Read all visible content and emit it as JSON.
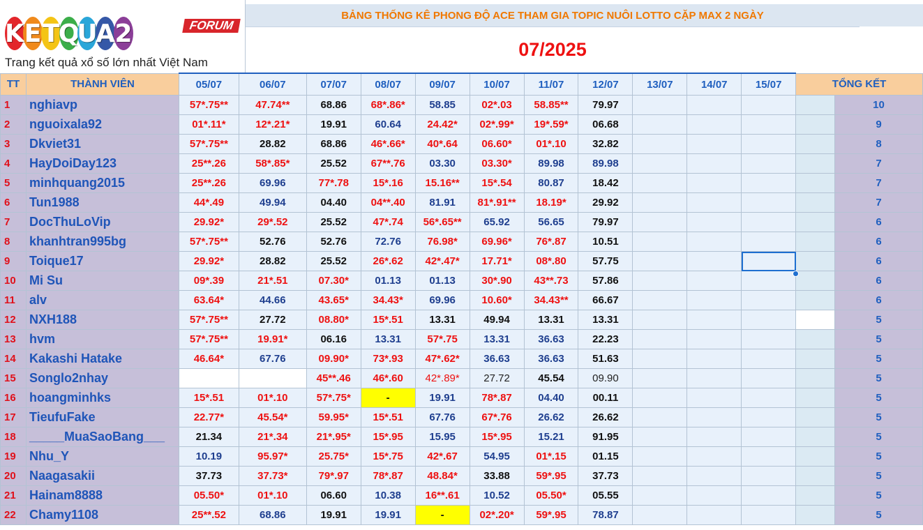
{
  "logo": {
    "letters": [
      "K",
      "E",
      "T",
      "Q",
      "U",
      "A",
      "2"
    ],
    "colors": [
      "#e3262b",
      "#f08a1c",
      "#f4c415",
      "#3bae49",
      "#2aa6d9",
      "#3558a7",
      "#8b3e98"
    ],
    "badge": "FORUM",
    "tagline": "Trang kết quả xổ số lớn nhất Việt Nam"
  },
  "title": "BẢNG THỐNG KÊ PHONG ĐỘ ACE THAM GIA TOPIC NUÔI LOTTO CẶP MAX 2 NGÀY",
  "month": "07/2025",
  "headers": {
    "tt": "TT",
    "name": "THÀNH VIÊN",
    "total": "TỔNG KẾT"
  },
  "dates": [
    "05/07",
    "06/07",
    "07/07",
    "08/07",
    "09/07",
    "10/07",
    "11/07",
    "12/07",
    "13/07",
    "14/07",
    "15/07"
  ],
  "rows": [
    {
      "tt": "1",
      "name": "nghiavp",
      "cells": [
        "57*.75**",
        "47.74**",
        "68.86",
        "68*.86*",
        "58.85",
        "02*.03",
        "58.85**",
        "79.97"
      ],
      "total": "10"
    },
    {
      "tt": "2",
      "name": "nguoixala92",
      "cells": [
        "01*.11*",
        "12*.21*",
        "19.91",
        "60.64",
        "24.42*",
        "02*.99*",
        "19*.59*",
        "06.68"
      ],
      "total": "9"
    },
    {
      "tt": "3",
      "name": "Dkviet31",
      "cells": [
        "57*.75**",
        "28.82",
        "68.86",
        "46*.66*",
        "40*.64",
        "06.60*",
        "01*.10",
        "32.82"
      ],
      "total": "8"
    },
    {
      "tt": "4",
      "name": "HayDoiDay123",
      "cells": [
        "25**.26",
        "58*.85*",
        "25.52",
        "67**.76",
        "03.30",
        "03.30*",
        "89.98",
        "89.98"
      ],
      "total": "7"
    },
    {
      "tt": "5",
      "name": "minhquang2015",
      "cells": [
        "25**.26",
        "69.96",
        "77*.78",
        "15*.16",
        "15.16**",
        "15*.54",
        "80.87",
        "18.42"
      ],
      "total": "7"
    },
    {
      "tt": "6",
      "name": "Tun1988",
      "cells": [
        "44*.49",
        "49.94",
        "04.40",
        "04**.40",
        "81.91",
        "81*.91**",
        "18.19*",
        "29.92"
      ],
      "total": "7"
    },
    {
      "tt": "7",
      "name": "DocThuLoVip",
      "cells": [
        "29.92*",
        "29*.52",
        "25.52",
        "47*.74",
        "56*.65**",
        "65.92",
        "56.65",
        "79.97"
      ],
      "total": "6"
    },
    {
      "tt": "8",
      "name": "khanhtran995bg",
      "cells": [
        "57*.75**",
        "52.76",
        "52.76",
        "72.76",
        "76.98*",
        "69.96*",
        "76*.87",
        "10.51"
      ],
      "total": "6"
    },
    {
      "tt": "9",
      "name": "Toique17",
      "cells": [
        "29.92*",
        "28.82",
        "25.52",
        "26*.62",
        "42*.47*",
        "17.71*",
        "08*.80",
        "57.75"
      ],
      "total": "6"
    },
    {
      "tt": "10",
      "name": "Mi Su",
      "cells": [
        "09*.39",
        "21*.51",
        "07.30*",
        "01.13",
        "01.13",
        "30*.90",
        "43**.73",
        "57.86"
      ],
      "total": "6"
    },
    {
      "tt": "11",
      "name": "alv",
      "cells": [
        "63.64*",
        "44.66",
        "43.65*",
        "34.43*",
        "69.96",
        "10.60*",
        "34.43**",
        "66.67"
      ],
      "total": "6"
    },
    {
      "tt": "12",
      "name": "NXH188",
      "cells": [
        "57*.75**",
        "27.72",
        "08.80*",
        "15*.51",
        "13.31",
        "49.94",
        "13.31",
        "13.31"
      ],
      "total": "5"
    },
    {
      "tt": "13",
      "name": "hvm",
      "cells": [
        "57*.75**",
        "19.91*",
        "06.16",
        "13.31",
        "57*.75",
        "13.31",
        "36.63",
        "22.23"
      ],
      "total": "5"
    },
    {
      "tt": "14",
      "name": "Kakashi Hatake",
      "cells": [
        "46.64*",
        "67.76",
        "09.90*",
        "73*.93",
        "47*.62*",
        "36.63",
        "36.63",
        "51.63"
      ],
      "total": "5"
    },
    {
      "tt": "15",
      "name": "Songlo2nhay",
      "cells": [
        "",
        "",
        "45**.46",
        "46*.60",
        "42*.89*",
        "27.72",
        "45.54",
        "09.90"
      ],
      "total": "5"
    },
    {
      "tt": "16",
      "name": "hoangminhks",
      "cells": [
        "15*.51",
        "01*.10",
        "57*.75*",
        "-",
        "19.91",
        "78*.87",
        "04.40",
        "00.11"
      ],
      "total": "5"
    },
    {
      "tt": "17",
      "name": "TieufuFake",
      "cells": [
        "22.77*",
        "45.54*",
        "59.95*",
        "15*.51",
        "67.76",
        "67*.76",
        "26.62",
        "26.62"
      ],
      "total": "5"
    },
    {
      "tt": "18",
      "name": "_____MuaSaoBang___",
      "cells": [
        "21.34",
        "21*.34",
        "21*.95*",
        "15*.95",
        "15.95",
        "15*.95",
        "15.21",
        "91.95"
      ],
      "total": "5"
    },
    {
      "tt": "19",
      "name": "Nhu_Y",
      "cells": [
        "10.19",
        "95.97*",
        "25.75*",
        "15*.75",
        "42*.67",
        "54.95",
        "01*.15",
        "01.15"
      ],
      "total": "5"
    },
    {
      "tt": "20",
      "name": "Naagasakii",
      "cells": [
        "37.73",
        "37.73*",
        "79*.97",
        "78*.87",
        "48.84*",
        "33.88",
        "59*.95",
        "37.73"
      ],
      "total": "5"
    },
    {
      "tt": "21",
      "name": "Hainam8888",
      "cells": [
        "05.50*",
        "01*.10",
        "06.60",
        "10.38",
        "16**.61",
        "10.52",
        "05.50*",
        "05.55"
      ],
      "total": "5"
    },
    {
      "tt": "22",
      "name": "Chamy1108",
      "cells": [
        "25**.52",
        "68.86",
        "19.91",
        "19.91",
        "-",
        "02*.20*",
        "59*.95",
        "78.87"
      ],
      "total": "5"
    }
  ]
}
